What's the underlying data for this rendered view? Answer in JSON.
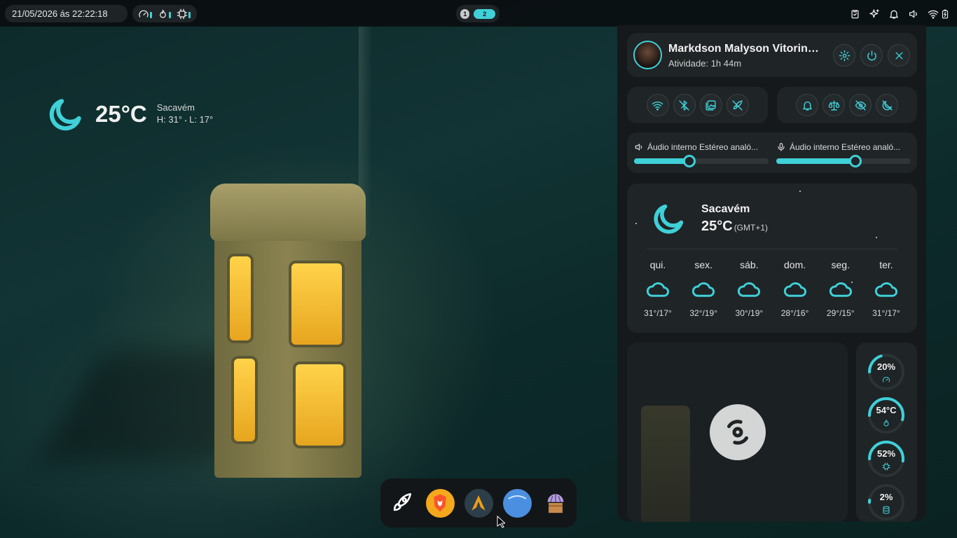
{
  "topbar": {
    "datetime": "21/05/2026 ás 22:22:18",
    "workspaces": [
      "1",
      "2"
    ],
    "tray_icons": [
      "clipboard-icon",
      "sparkle-icon",
      "bell-icon",
      "volume-icon",
      "wifi-icon",
      "battery-icon"
    ]
  },
  "desktop_weather": {
    "icon": "moon-icon",
    "temperature": "25°C",
    "city": "Sacavém",
    "high_label": "H:",
    "high": "31°",
    "separator": "•",
    "low_label": "L:",
    "low": "17°"
  },
  "dock": {
    "apps": [
      "rocket-launcher-icon",
      "brave-browser-icon",
      "arch-linux-icon",
      "blue-app-icon",
      "shell-package-icon"
    ]
  },
  "panel": {
    "profile": {
      "name": "Markdson Malyson Vitorino...",
      "activity": "Atividade: 1h 44m"
    },
    "audio": {
      "output_label": "Áudio interno Estéreo analó...",
      "output_level": 0.41,
      "input_label": "Áudio interno Estéreo analó...",
      "input_level": 0.59
    },
    "weather": {
      "city": "Sacavém",
      "temperature": "25°C",
      "timezone": "(GMT+1)",
      "forecast": [
        {
          "day": "qui.",
          "range": "31°/17°"
        },
        {
          "day": "sex.",
          "range": "32°/19°"
        },
        {
          "day": "sáb.",
          "range": "30°/19°"
        },
        {
          "day": "dom.",
          "range": "28°/16°"
        },
        {
          "day": "seg.",
          "range": "29°/15°"
        },
        {
          "day": "ter.",
          "range": "31°/17°"
        }
      ]
    },
    "system": {
      "cpu": "20%",
      "cpu_level": 0.2,
      "temp": "54°C",
      "temp_level": 0.54,
      "ram": "52%",
      "ram_level": 0.52,
      "disk": "2%",
      "disk_level": 0.02
    }
  },
  "colors": {
    "accent": "#3fd0d8",
    "panel_bg": "#15191b",
    "card_bg": "#1f2426"
  }
}
